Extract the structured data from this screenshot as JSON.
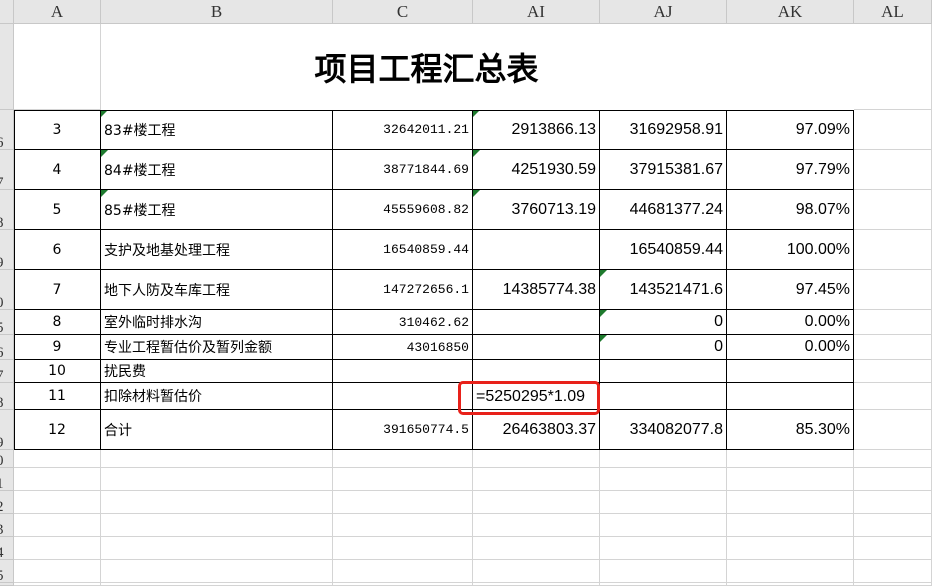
{
  "columns": [
    "A",
    "B",
    "C",
    "AI",
    "AJ",
    "AK",
    "AL"
  ],
  "title": "项目工程汇总表",
  "row_numbers": [
    "6",
    "7",
    "8",
    "9",
    "0",
    "5",
    "6",
    "7",
    "8",
    "9",
    "0",
    "1",
    "2",
    "3",
    "4",
    "5",
    "6"
  ],
  "rows": [
    {
      "no": "3",
      "name": "83#楼工程",
      "c": "32642011.21",
      "ai": "2913866.13",
      "aj": "31692958.91",
      "ak": "97.09%"
    },
    {
      "no": "4",
      "name": "84#楼工程",
      "c": "38771844.69",
      "ai": "4251930.59",
      "aj": "37915381.67",
      "ak": "97.79%"
    },
    {
      "no": "5",
      "name": "85#楼工程",
      "c": "45559608.82",
      "ai": "3760713.19",
      "aj": "44681377.24",
      "ak": "98.07%"
    },
    {
      "no": "6",
      "name": "支护及地基处理工程",
      "c": "16540859.44",
      "ai": "",
      "aj": "16540859.44",
      "ak": "100.00%"
    },
    {
      "no": "7",
      "name": "地下人防及车库工程",
      "c": "147272656.1",
      "ai": "14385774.38",
      "aj": "143521471.6",
      "ak": "97.45%"
    },
    {
      "no": "8",
      "name": "室外临时排水沟",
      "c": "310462.62",
      "ai": "",
      "aj": "0",
      "ak": "0.00%"
    },
    {
      "no": "9",
      "name": "专业工程暂估价及暂列金额",
      "c": "43016850",
      "ai": "",
      "aj": "0",
      "ak": "0.00%"
    },
    {
      "no": "10",
      "name": "扰民费",
      "c": "",
      "ai": "",
      "aj": "",
      "ak": ""
    },
    {
      "no": "11",
      "name": "扣除材料暂估价",
      "c": "",
      "ai": "",
      "aj": "",
      "ak": ""
    },
    {
      "no": "12",
      "name": "合计",
      "c": "391650774.5",
      "ai": "26463803.37",
      "aj": "334082077.8",
      "ak": "85.30%"
    }
  ],
  "editing_cell": {
    "formula": "=5250295*1.09"
  },
  "colors": {
    "header_bg": "#e6e6e6",
    "highlight": "#e8211a",
    "error_marker": "#1e7a2e"
  }
}
